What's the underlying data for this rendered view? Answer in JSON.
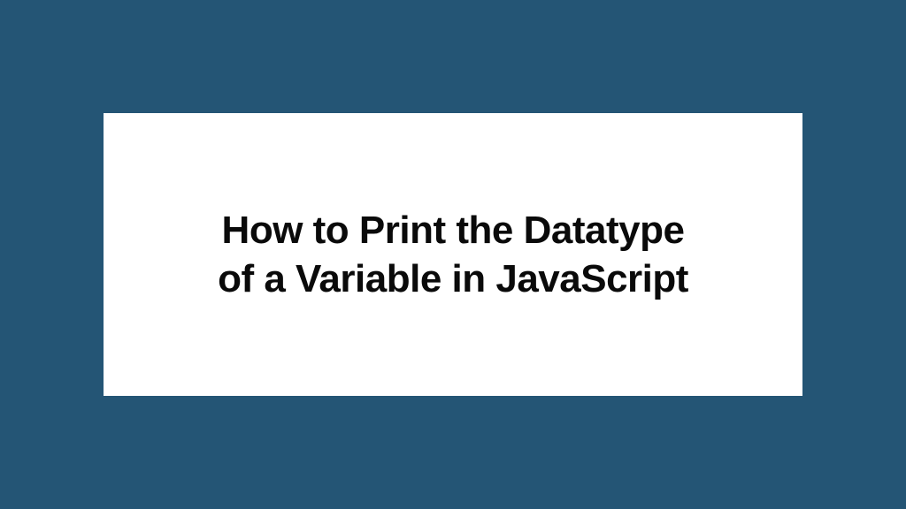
{
  "card": {
    "title_line1": "How to Print the Datatype",
    "title_line2": "of a Variable in JavaScript"
  }
}
